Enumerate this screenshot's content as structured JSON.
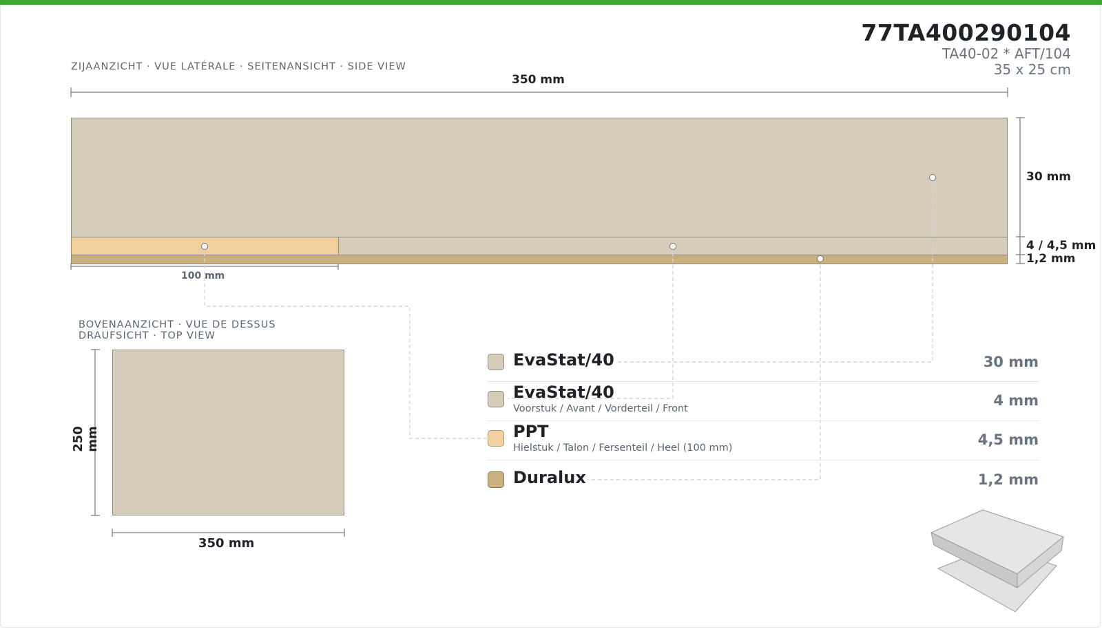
{
  "header": {
    "code": "77TA400290104",
    "subcode": "TA40-02 * AFT/104",
    "size": "35 x 25 cm"
  },
  "side_view": {
    "caption": "ZIJAANZICHT · VUE LATÉRALE · SEITENANSICHT · SIDE VIEW",
    "length_label": "350 mm",
    "heel_label": "100 mm",
    "top_thickness_label": "30 mm",
    "middle_thickness_label": "4 / 4,5 mm",
    "bottom_thickness_label": "1,2 mm"
  },
  "top_view": {
    "caption_line1": "BOVENAANZICHT · VUE DE DESSUS",
    "caption_line2": "DRAUFSICHT · TOP VIEW",
    "width_label": "350 mm",
    "height_label": "250 mm"
  },
  "colors": {
    "accent": "#3aaa35",
    "evastat": "#d5cdb9",
    "ppt": "#f2d09e",
    "duralux": "#c9b07d",
    "outline": "#8d8a82",
    "dimension": "#7a7f8c"
  },
  "layers": [
    {
      "name": "EvaStat/40",
      "desc": "",
      "thickness": "30 mm",
      "color": "#d5cdb9"
    },
    {
      "name": "EvaStat/40",
      "desc": "Voorstuk / Avant / Vorderteil / Front",
      "thickness": "4 mm",
      "color": "#d5cdb9"
    },
    {
      "name": "PPT",
      "desc": "Hielstuk / Talon / Fersenteil / Heel (100 mm)",
      "thickness": "4,5 mm",
      "color": "#f2d09e"
    },
    {
      "name": "Duralux",
      "desc": "",
      "thickness": "1,2 mm",
      "color": "#c9b07d"
    }
  ],
  "icons": {
    "preview": "layered-sheet-isometric-icon"
  }
}
